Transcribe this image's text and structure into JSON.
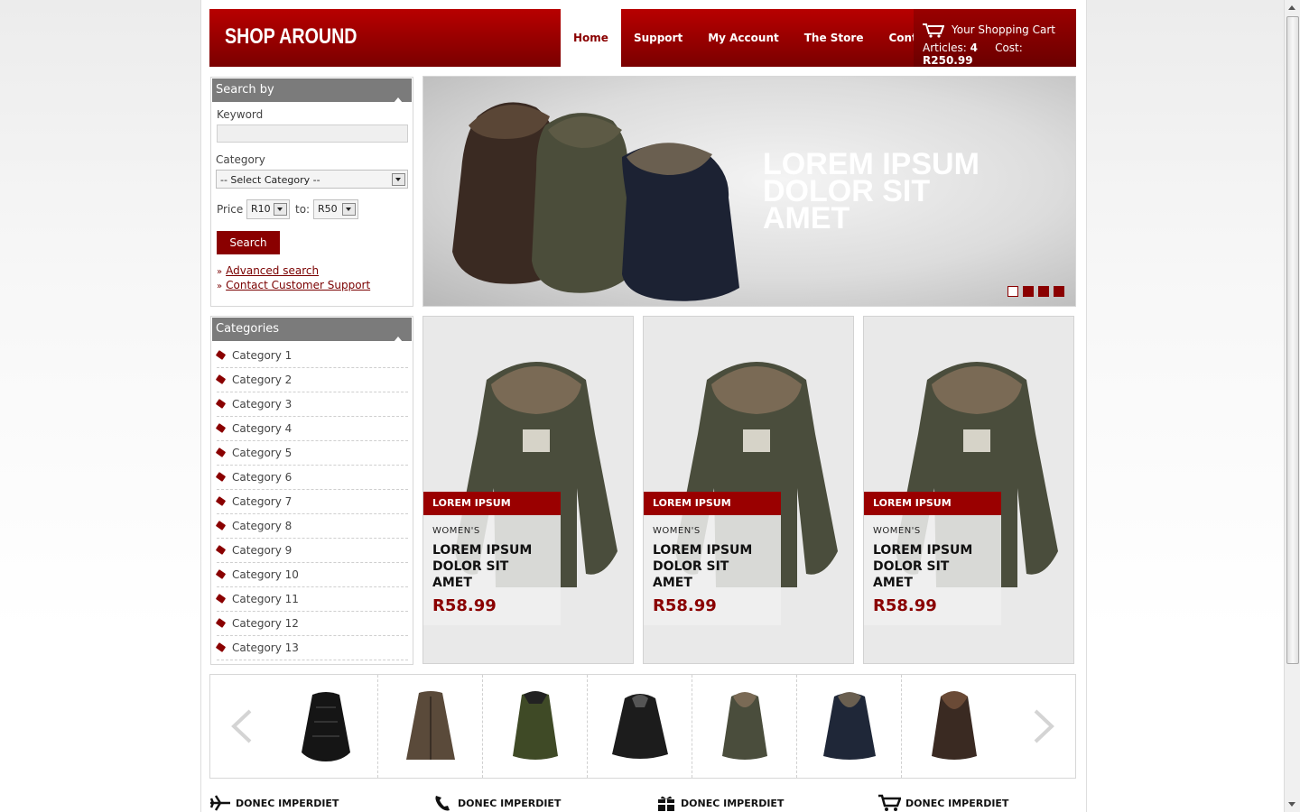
{
  "header": {
    "logo": "SHOP AROUND",
    "nav": [
      "Home",
      "Support",
      "My Account",
      "The Store",
      "Contact"
    ],
    "cart": {
      "title": "Your Shopping Cart",
      "articles_label": "Articles:",
      "articles_value": "4",
      "cost_label": "Cost:",
      "cost_value": "R250.99"
    }
  },
  "search": {
    "title": "Search by",
    "keyword_label": "Keyword",
    "keyword_value": "",
    "category_label": "Category",
    "category_selected": "-- Select Category --",
    "price_label": "Price",
    "price_from": "R10",
    "to_label": "to:",
    "price_to": "R50",
    "button": "Search",
    "links": [
      "Advanced search",
      "Contact Customer Support"
    ]
  },
  "categories": {
    "title": "Categories",
    "items": [
      "Category 1",
      "Category 2",
      "Category 3",
      "Category 4",
      "Category 5",
      "Category 6",
      "Category 7",
      "Category 8",
      "Category 9",
      "Category 10",
      "Category 11",
      "Category 12",
      "Category 13"
    ]
  },
  "slider": {
    "text": "LOREM IPSUM\nDOLOR SIT\nAMET",
    "dots": 4,
    "active_dot": 0
  },
  "products": [
    {
      "tag": "LOREM IPSUM",
      "sub": "WOMEN'S",
      "title": "LOREM IPSUM\nDOLOR SIT\nAMET",
      "price": "R58.99"
    },
    {
      "tag": "LOREM IPSUM",
      "sub": "WOMEN'S",
      "title": "LOREM IPSUM\nDOLOR SIT\nAMET",
      "price": "R58.99"
    },
    {
      "tag": "LOREM IPSUM",
      "sub": "WOMEN'S",
      "title": "LOREM IPSUM\nDOLOR SIT\nAMET",
      "price": "R58.99"
    }
  ],
  "features": [
    {
      "icon": "airplane-icon",
      "label": "DONEC IMPERDIET"
    },
    {
      "icon": "phone-icon",
      "label": "DONEC IMPERDIET"
    },
    {
      "icon": "gift-icon",
      "label": "DONEC IMPERDIET"
    },
    {
      "icon": "cart-icon",
      "label": "DONEC IMPERDIET"
    }
  ],
  "colors": {
    "brand": "#8a0000",
    "header_gradient_top": "#b80000",
    "box_head": "#7b7b7b"
  }
}
